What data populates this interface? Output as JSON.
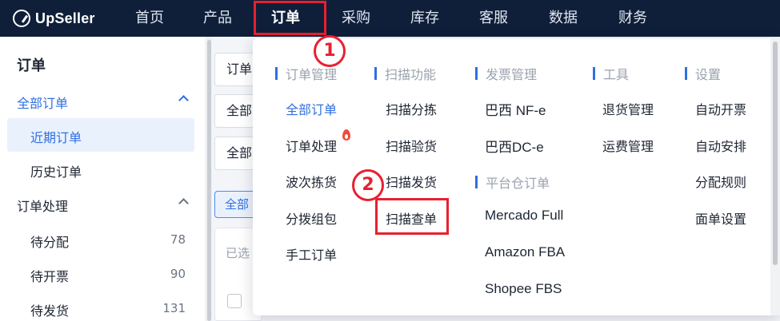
{
  "brand": {
    "name": "UpSeller",
    "accent": "#2f6fe0",
    "highlight": "#e8202f",
    "nav_bg": "#0f1f3a"
  },
  "nav": {
    "items": [
      {
        "label": "首页"
      },
      {
        "label": "产品"
      },
      {
        "label": "订单"
      },
      {
        "label": "采购"
      },
      {
        "label": "库存"
      },
      {
        "label": "客服"
      },
      {
        "label": "数据"
      },
      {
        "label": "财务"
      }
    ],
    "active": "订单"
  },
  "annotations": {
    "step1": "1",
    "step2": "2"
  },
  "sidebar": {
    "title": "订单",
    "groups": [
      {
        "label": "全部订单",
        "items": [
          {
            "label": "近期订单",
            "selected": true
          },
          {
            "label": "历史订单"
          }
        ]
      },
      {
        "label": "订单处理",
        "items": [
          {
            "label": "待分配",
            "count": "78"
          },
          {
            "label": "待开票",
            "count": "90"
          },
          {
            "label": "待发货",
            "count": "131"
          }
        ]
      }
    ]
  },
  "background": {
    "field1": "订单",
    "field2": "全部",
    "field3": "全部",
    "tab_all": "全部",
    "selected_text": "已选"
  },
  "menu": {
    "columns": [
      {
        "header": "订单管理",
        "items": [
          "全部订单",
          "订单处理",
          "波次拣货",
          "分拨组包",
          "手工订单"
        ]
      },
      {
        "header": "扫描功能",
        "items": [
          "扫描分拣",
          "扫描验货",
          "扫描发货",
          "扫描查单"
        ]
      },
      {
        "header": "发票管理",
        "items": [
          "巴西 NF-e",
          "巴西DC-e"
        ],
        "header2": "平台仓订单",
        "items2": [
          "Mercado Full",
          "Amazon FBA",
          "Shopee FBS"
        ]
      },
      {
        "header": "工具",
        "items": [
          "退货管理",
          "运费管理"
        ]
      },
      {
        "header": "设置",
        "items": [
          "自动开票",
          "自动安排",
          "分配规则",
          "面单设置"
        ]
      }
    ],
    "selected_item": "全部订单",
    "hot_item": "订单处理",
    "highlighted_item": "扫描查单"
  }
}
